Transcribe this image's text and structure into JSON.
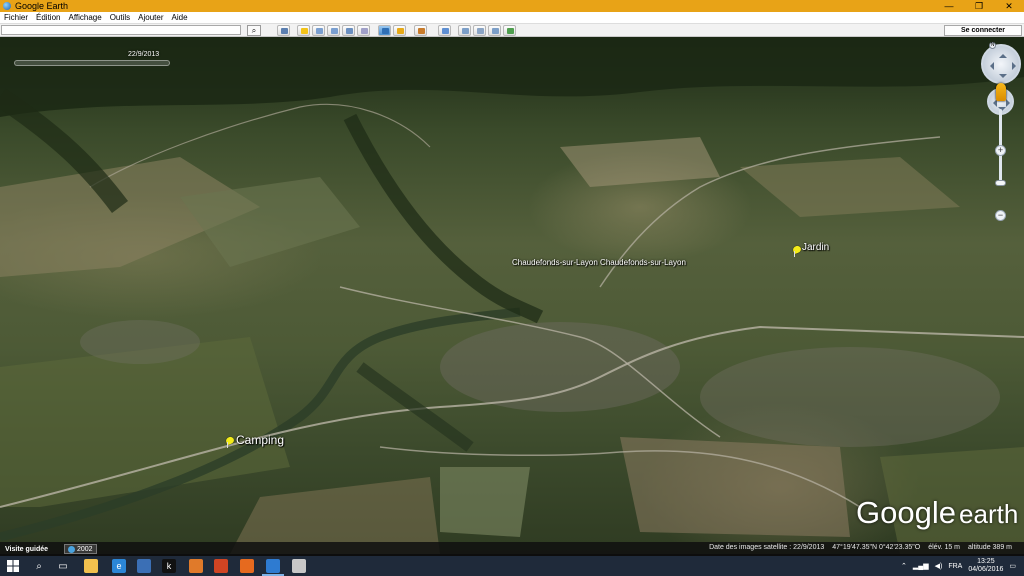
{
  "window": {
    "title": "Google Earth"
  },
  "menu": [
    "Fichier",
    "Édition",
    "Affichage",
    "Outils",
    "Ajouter",
    "Aide"
  ],
  "toolbar": {
    "search_value": "",
    "sign_in_label": "Se connecter",
    "tools": [
      {
        "name": "sidebar-toggle-icon",
        "color": "#5b7fb0"
      },
      {
        "name": "placemark-icon",
        "color": "#f2c318"
      },
      {
        "name": "polygon-icon",
        "color": "#7a9fd0"
      },
      {
        "name": "path-icon",
        "color": "#7a9fd0"
      },
      {
        "name": "overlay-icon",
        "color": "#6a8fc0"
      },
      {
        "name": "tour-icon",
        "color": "#a0a0c8"
      },
      {
        "name": "history-icon",
        "color": "#2f6fb5",
        "active": true
      },
      {
        "name": "sunlight-icon",
        "color": "#e6a917"
      },
      {
        "name": "planets-icon",
        "color": "#c87b2a"
      },
      {
        "name": "ruler-icon",
        "color": "#5e8fd2"
      },
      {
        "name": "email-icon",
        "color": "#7c9fc8"
      },
      {
        "name": "print-icon",
        "color": "#8aa4c4"
      },
      {
        "name": "save-image-icon",
        "color": "#7c9fc8"
      },
      {
        "name": "maps-icon",
        "color": "#4e9e4e"
      }
    ]
  },
  "viewport": {
    "time_slider_label": "22/9/2013",
    "places": [
      {
        "label": "Chaudefonds-sur-Layon  Chaudefonds-sur-Layon"
      },
      {
        "label": "Jardin"
      },
      {
        "label": "Camping"
      }
    ],
    "logo": {
      "google": "Google",
      "earth": "earth"
    }
  },
  "status": {
    "tour_label": "Visite guidée",
    "history_year": "2002",
    "imagery_date": "Date des images satellite : 22/9/2013",
    "coordinates": "47°19'47.35\"N  0°42'23.35\"O",
    "elevation": "élév.  15 m",
    "altitude": "altitude  389 m"
  },
  "taskbar": {
    "apps": [
      {
        "name": "search-icon",
        "glyph": "⌕",
        "color": ""
      },
      {
        "name": "task-view-icon",
        "glyph": "▭",
        "color": ""
      },
      {
        "name": "file-explorer-icon",
        "glyph": "",
        "color": "#f2c14e"
      },
      {
        "name": "edge-icon",
        "glyph": "e",
        "color": "#2b86d6"
      },
      {
        "name": "store-icon",
        "glyph": "",
        "color": "#3b6fb5"
      },
      {
        "name": "k-app-icon",
        "glyph": "k",
        "color": "#111111"
      },
      {
        "name": "media-icon",
        "glyph": "",
        "color": "#e07a2a"
      },
      {
        "name": "powerpoint-icon",
        "glyph": "",
        "color": "#d04423"
      },
      {
        "name": "firefox-icon",
        "glyph": "",
        "color": "#e66a1f"
      },
      {
        "name": "google-earth-icon",
        "glyph": "",
        "color": "#2e7bd1",
        "open": true
      },
      {
        "name": "app-icon",
        "glyph": "",
        "color": "#c8c8c8"
      }
    ],
    "language": "FRA",
    "time": "13:25",
    "date": "04/06/2016"
  }
}
